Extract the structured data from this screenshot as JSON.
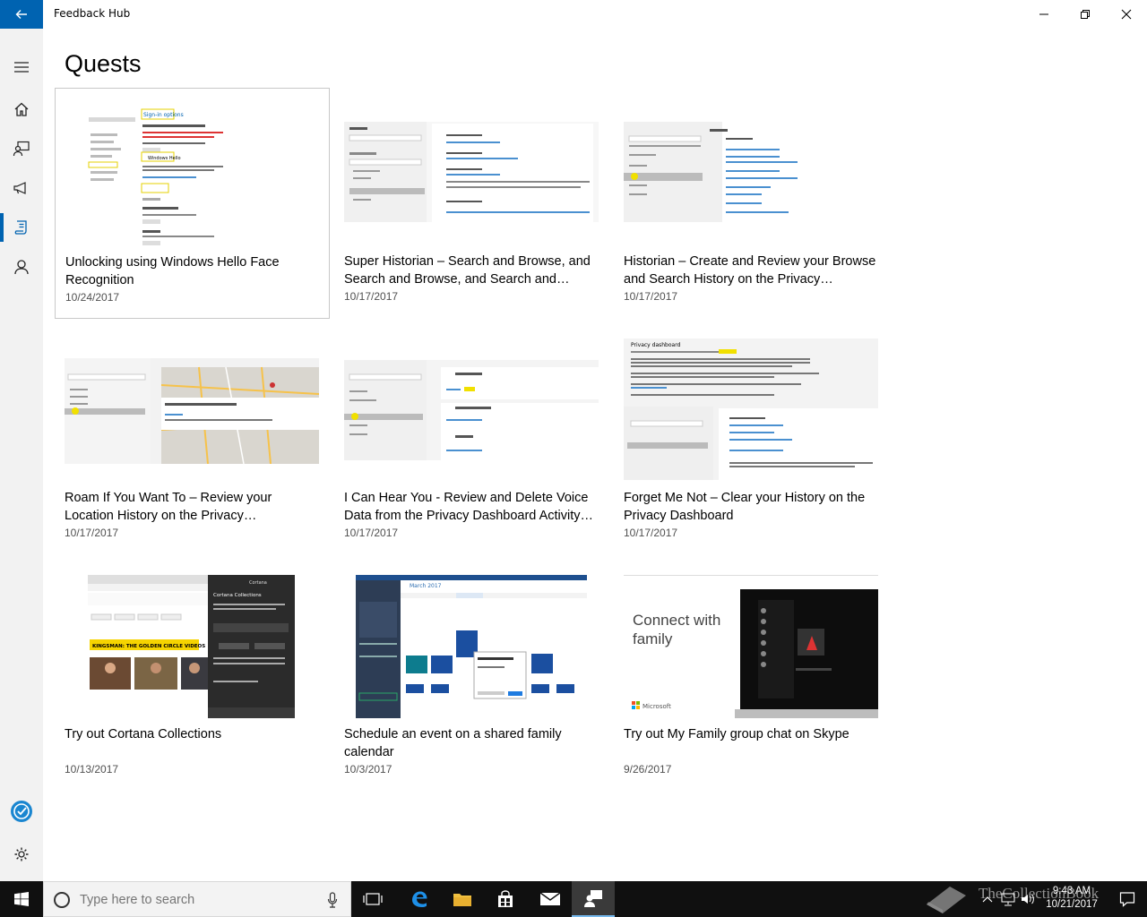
{
  "app": {
    "title": "Feedback Hub"
  },
  "page": {
    "title": "Quests"
  },
  "sidebar": {
    "items": [
      {
        "name": "menu",
        "icon": "hamburger-icon"
      },
      {
        "name": "home",
        "icon": "home-icon"
      },
      {
        "name": "feedback",
        "icon": "feedback-icon"
      },
      {
        "name": "announcements",
        "icon": "megaphone-icon"
      },
      {
        "name": "quests",
        "icon": "quest-icon",
        "active": true
      },
      {
        "name": "achievements",
        "icon": "person-icon"
      }
    ],
    "bottom": [
      {
        "name": "insider",
        "icon": "insider-badge-icon"
      },
      {
        "name": "settings",
        "icon": "gear-icon"
      }
    ]
  },
  "quests": [
    {
      "title": "Unlocking using Windows Hello Face Recognition",
      "date": "10/24/2017"
    },
    {
      "title": "Super Historian – Search and Browse, and Search and Browse, and Search and…",
      "date": "10/17/2017"
    },
    {
      "title": "Historian – Create and Review your Browse and Search History on the Privacy…",
      "date": "10/17/2017"
    },
    {
      "title": "Roam If You Want To – Review your Location History on the Privacy…",
      "date": "10/17/2017"
    },
    {
      "title": "I Can Hear You - Review and Delete Voice Data from the Privacy Dashboard Activity…",
      "date": "10/17/2017"
    },
    {
      "title": "Forget Me Not – Clear your History on the Privacy Dashboard",
      "date": "10/17/2017"
    },
    {
      "title": "Try out Cortana Collections",
      "date": "10/13/2017"
    },
    {
      "title": "Schedule an event on a shared family calendar",
      "date": "10/3/2017"
    },
    {
      "title": "Try out My Family group chat on Skype",
      "date": "9/26/2017"
    }
  ],
  "thumbs": {
    "hello": {
      "heading": "Sign-in options",
      "sub": "Windows Hello"
    },
    "privacy": {
      "heading": "Privacy dashboard"
    },
    "cortana": {
      "banner": "KINGSMAN: THE GOLDEN CIRCLE VIDEOS",
      "panel_title": "Cortana Collections"
    },
    "calendar": {
      "month": "March 2017"
    },
    "skype": {
      "headline": "Connect with family",
      "brand": "Microsoft"
    }
  },
  "taskbar": {
    "search_placeholder": "Type here to search",
    "time": "9:43 AM",
    "date": "10/21/2017"
  },
  "watermark": {
    "text": "TheCollectionBook"
  },
  "colors": {
    "accent": "#0063b1",
    "taskbar": "#101010",
    "sidebar": "#f2f2f2"
  }
}
